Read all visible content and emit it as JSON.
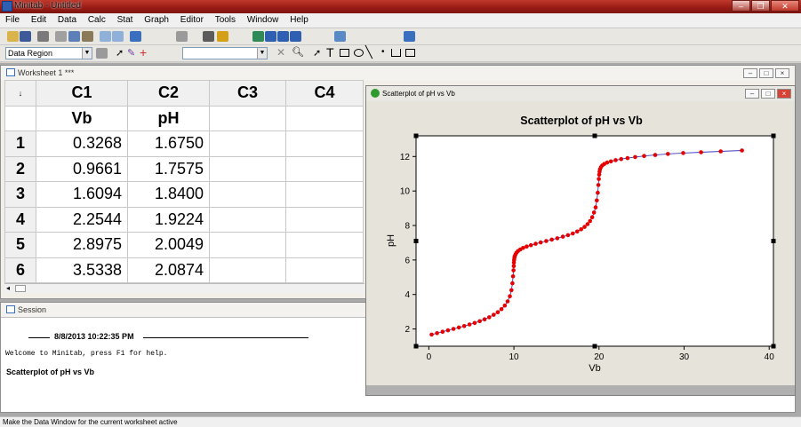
{
  "app": {
    "title": "Minitab - Untitled",
    "window_controls": [
      "–",
      "❐",
      "✕"
    ]
  },
  "menu": [
    "File",
    "Edit",
    "Data",
    "Calc",
    "Stat",
    "Graph",
    "Editor",
    "Tools",
    "Window",
    "Help"
  ],
  "toolbar": {
    "region_combo": "Data Region",
    "text_combo": "",
    "icons": [
      "open-icon",
      "save-icon",
      "print-icon",
      "cut-icon",
      "copy-icon",
      "paste-icon",
      "undo-icon",
      "redo-icon",
      "graph-icon",
      "find-icon",
      "help-icon",
      "cancel-icon",
      "select-icon",
      "brush-icon",
      "crosshair-icon",
      "zoom-icon",
      "arrow-icon",
      "text-tool-icon",
      "rectangle-icon",
      "ellipse-icon",
      "line-icon",
      "marker-icon",
      "polyline-icon",
      "polygon-icon"
    ]
  },
  "worksheet": {
    "title": "Worksheet 1 ***",
    "corner": "↓",
    "columns": [
      "C1",
      "C2",
      "C3",
      "C4"
    ],
    "names": [
      "Vb",
      "pH",
      "",
      ""
    ],
    "rows": [
      {
        "n": "1",
        "c1": "0.3268",
        "c2": "1.6750"
      },
      {
        "n": "2",
        "c1": "0.9661",
        "c2": "1.7575"
      },
      {
        "n": "3",
        "c1": "1.6094",
        "c2": "1.8400"
      },
      {
        "n": "4",
        "c1": "2.2544",
        "c2": "1.9224"
      },
      {
        "n": "5",
        "c1": "2.8975",
        "c2": "2.0049"
      },
      {
        "n": "6",
        "c1": "3.5338",
        "c2": "2.0874"
      }
    ]
  },
  "session": {
    "title": "Session",
    "timestamp": "8/8/2013 10:22:35 PM",
    "welcome": "Welcome to Minitab, press F1 for help.",
    "output_title": "Scatterplot of pH vs Vb"
  },
  "graph_window": {
    "title": "Scatterplot of pH vs Vb"
  },
  "chart_data": {
    "type": "scatter",
    "title": "Scatterplot of pH vs Vb",
    "xlabel": "Vb",
    "ylabel": "pH",
    "xlim": [
      -1.5,
      40.5
    ],
    "ylim": [
      1.0,
      13.2
    ],
    "xticks": [
      0,
      10,
      20,
      30,
      40
    ],
    "yticks": [
      2,
      4,
      6,
      8,
      10,
      12
    ],
    "grid": false,
    "point_color": "#e60000",
    "line_color": "#3a3ac4",
    "series": [
      {
        "x": [
          0.3268,
          0.9661,
          1.6094,
          2.2544,
          2.8975,
          3.5338,
          4.16,
          4.78,
          5.39,
          5.98,
          6.55,
          7.1,
          7.62,
          8.1,
          8.54,
          8.93,
          9.26,
          9.52,
          9.71,
          9.83,
          9.9,
          9.95,
          9.98,
          10.0,
          10.02,
          10.05,
          10.1,
          10.18,
          10.3,
          10.48,
          10.74,
          11.08,
          11.5,
          12.0,
          12.55,
          13.15,
          13.8,
          14.45,
          15.1,
          15.75,
          16.35,
          16.92,
          17.44,
          17.9,
          18.3,
          18.65,
          18.95,
          19.2,
          19.42,
          19.6,
          19.74,
          19.85,
          19.93,
          19.98,
          20.02,
          20.06,
          20.12,
          20.22,
          20.38,
          20.62,
          20.95,
          21.4,
          21.95,
          22.6,
          23.35,
          24.25,
          25.3,
          26.6,
          28.1,
          29.9,
          32.0,
          34.3,
          36.8
        ],
        "y": [
          1.675,
          1.7575,
          1.84,
          1.9224,
          2.0049,
          2.0874,
          2.17,
          2.26,
          2.35,
          2.45,
          2.56,
          2.68,
          2.82,
          2.97,
          3.15,
          3.36,
          3.6,
          3.9,
          4.25,
          4.65,
          5.05,
          5.4,
          5.65,
          5.85,
          6.0,
          6.12,
          6.22,
          6.32,
          6.42,
          6.52,
          6.61,
          6.7,
          6.78,
          6.86,
          6.94,
          7.02,
          7.1,
          7.18,
          7.26,
          7.35,
          7.44,
          7.54,
          7.65,
          7.78,
          7.92,
          8.08,
          8.26,
          8.48,
          8.75,
          9.05,
          9.45,
          9.9,
          10.35,
          10.7,
          10.95,
          11.12,
          11.26,
          11.38,
          11.48,
          11.57,
          11.65,
          11.72,
          11.79,
          11.85,
          11.91,
          11.97,
          12.03,
          12.09,
          12.15,
          12.2,
          12.25,
          12.3,
          12.35
        ]
      }
    ]
  },
  "status": {
    "text": "Make the Data Window for the current worksheet active"
  }
}
